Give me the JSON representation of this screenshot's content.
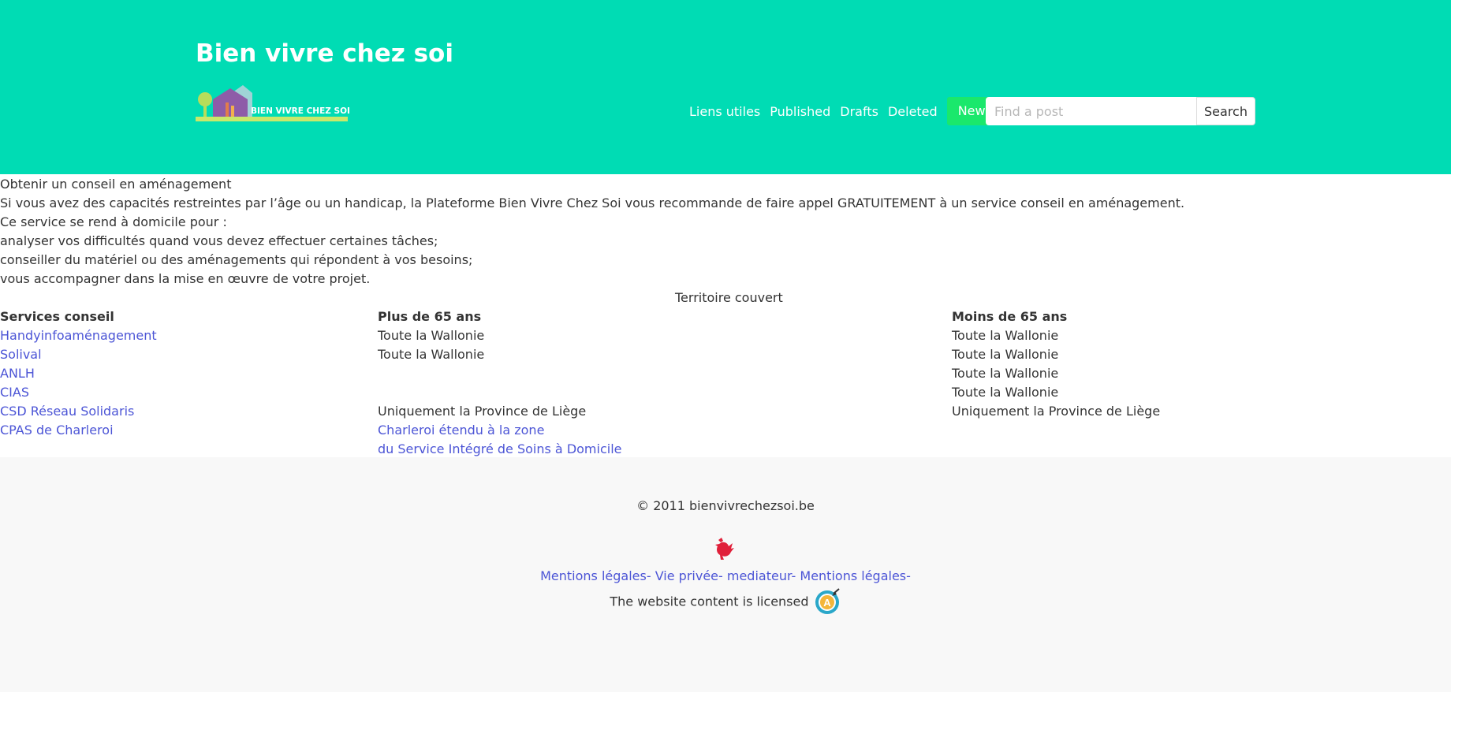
{
  "header": {
    "site_title": "Bien vivre chez soi",
    "logo_text": "BIEN VIVRE CHEZ SOI",
    "nav": [
      "Liens utiles",
      "Published",
      "Drafts",
      "Deleted"
    ],
    "new_label": "New",
    "search_placeholder": "Find a post",
    "search_label": "Search",
    "colors": {
      "background": "#00dcb4",
      "new_button": "#1ae86c"
    }
  },
  "content": {
    "intro": [
      "Obtenir un conseil en aménagement",
      "Si vous avez des capacités restreintes par l’âge ou un handicap, la Plateforme Bien Vivre Chez Soi vous recommande de faire appel GRATUITEMENT à un service conseil en aménagement.",
      "Ce service se rend à domicile pour :",
      "analyser vos difficultés quand vous devez effectuer certaines tâches;",
      "conseiller du matériel ou des aménagements qui répondent à vos besoins;",
      "vous accompagner dans la mise en œuvre de votre projet."
    ],
    "table": {
      "caption": "Territoire couvert",
      "headers": [
        "Services conseil",
        "Plus de 65 ans",
        "Moins de 65 ans"
      ],
      "rows": [
        [
          "Handyinfoaménagement",
          "Toute la Wallonie",
          "Toute la Wallonie"
        ],
        [
          "Solival",
          "Toute la Wallonie",
          "Toute la Wallonie"
        ],
        [
          "ANLH",
          "",
          "Toute la Wallonie"
        ],
        [
          "CIAS",
          "",
          "Toute la Wallonie"
        ],
        [
          "CSD Réseau Solidaris",
          "Uniquement la Province de Liège",
          "Uniquement la Province de Liège"
        ],
        [
          "CPAS de Charleroi",
          "Charleroi étendu à la zone",
          ""
        ],
        [
          "",
          "du Service Intégré de Soins à Domicile",
          ""
        ]
      ],
      "link_color": "#4c55d6"
    }
  },
  "footer": {
    "copyright": "© 2011 bienvivrechezsoi.be",
    "links": [
      "Mentions légales-",
      "Vie privée-",
      "mediateur-",
      "Mentions légales-"
    ],
    "license_text": "The website content is licensed",
    "icons": [
      "wallonia-rooster-icon",
      "accessibility-badge-icon"
    ]
  }
}
